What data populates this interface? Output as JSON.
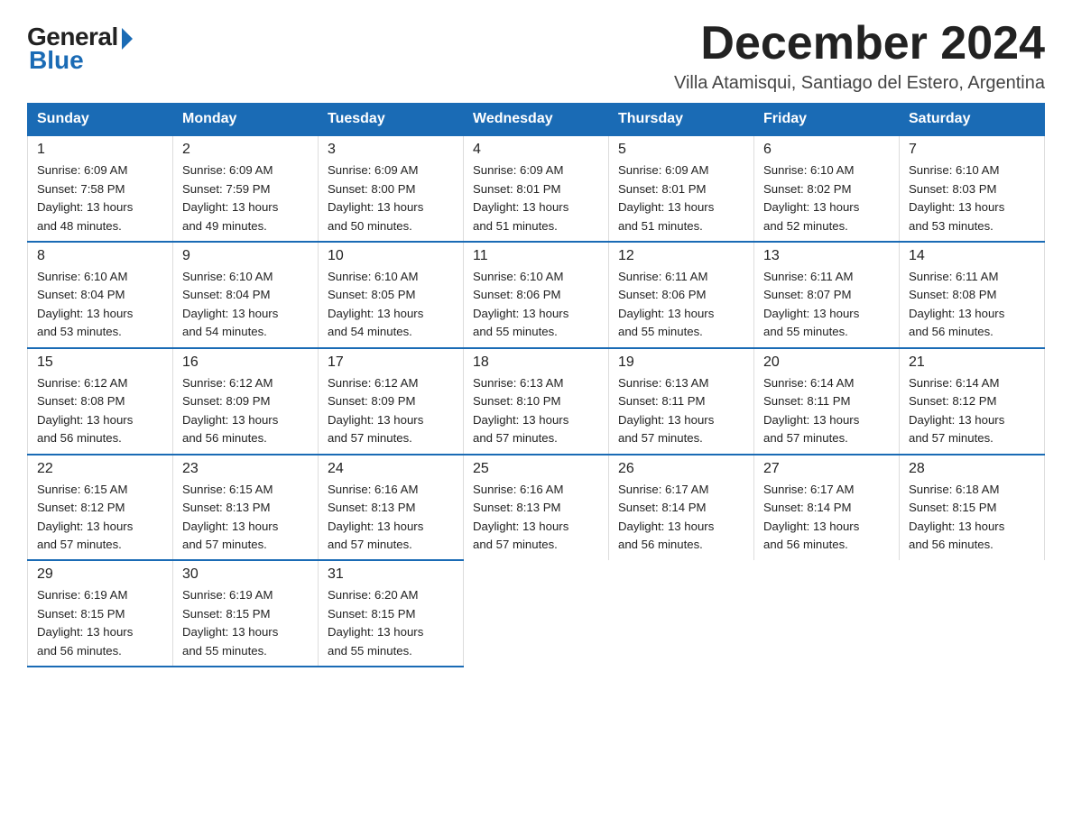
{
  "logo": {
    "general": "General",
    "blue": "Blue"
  },
  "title": "December 2024",
  "subtitle": "Villa Atamisqui, Santiago del Estero, Argentina",
  "days_of_week": [
    "Sunday",
    "Monday",
    "Tuesday",
    "Wednesday",
    "Thursday",
    "Friday",
    "Saturday"
  ],
  "weeks": [
    [
      {
        "day": "1",
        "sunrise": "6:09 AM",
        "sunset": "7:58 PM",
        "daylight": "13 hours and 48 minutes."
      },
      {
        "day": "2",
        "sunrise": "6:09 AM",
        "sunset": "7:59 PM",
        "daylight": "13 hours and 49 minutes."
      },
      {
        "day": "3",
        "sunrise": "6:09 AM",
        "sunset": "8:00 PM",
        "daylight": "13 hours and 50 minutes."
      },
      {
        "day": "4",
        "sunrise": "6:09 AM",
        "sunset": "8:01 PM",
        "daylight": "13 hours and 51 minutes."
      },
      {
        "day": "5",
        "sunrise": "6:09 AM",
        "sunset": "8:01 PM",
        "daylight": "13 hours and 51 minutes."
      },
      {
        "day": "6",
        "sunrise": "6:10 AM",
        "sunset": "8:02 PM",
        "daylight": "13 hours and 52 minutes."
      },
      {
        "day": "7",
        "sunrise": "6:10 AM",
        "sunset": "8:03 PM",
        "daylight": "13 hours and 53 minutes."
      }
    ],
    [
      {
        "day": "8",
        "sunrise": "6:10 AM",
        "sunset": "8:04 PM",
        "daylight": "13 hours and 53 minutes."
      },
      {
        "day": "9",
        "sunrise": "6:10 AM",
        "sunset": "8:04 PM",
        "daylight": "13 hours and 54 minutes."
      },
      {
        "day": "10",
        "sunrise": "6:10 AM",
        "sunset": "8:05 PM",
        "daylight": "13 hours and 54 minutes."
      },
      {
        "day": "11",
        "sunrise": "6:10 AM",
        "sunset": "8:06 PM",
        "daylight": "13 hours and 55 minutes."
      },
      {
        "day": "12",
        "sunrise": "6:11 AM",
        "sunset": "8:06 PM",
        "daylight": "13 hours and 55 minutes."
      },
      {
        "day": "13",
        "sunrise": "6:11 AM",
        "sunset": "8:07 PM",
        "daylight": "13 hours and 55 minutes."
      },
      {
        "day": "14",
        "sunrise": "6:11 AM",
        "sunset": "8:08 PM",
        "daylight": "13 hours and 56 minutes."
      }
    ],
    [
      {
        "day": "15",
        "sunrise": "6:12 AM",
        "sunset": "8:08 PM",
        "daylight": "13 hours and 56 minutes."
      },
      {
        "day": "16",
        "sunrise": "6:12 AM",
        "sunset": "8:09 PM",
        "daylight": "13 hours and 56 minutes."
      },
      {
        "day": "17",
        "sunrise": "6:12 AM",
        "sunset": "8:09 PM",
        "daylight": "13 hours and 57 minutes."
      },
      {
        "day": "18",
        "sunrise": "6:13 AM",
        "sunset": "8:10 PM",
        "daylight": "13 hours and 57 minutes."
      },
      {
        "day": "19",
        "sunrise": "6:13 AM",
        "sunset": "8:11 PM",
        "daylight": "13 hours and 57 minutes."
      },
      {
        "day": "20",
        "sunrise": "6:14 AM",
        "sunset": "8:11 PM",
        "daylight": "13 hours and 57 minutes."
      },
      {
        "day": "21",
        "sunrise": "6:14 AM",
        "sunset": "8:12 PM",
        "daylight": "13 hours and 57 minutes."
      }
    ],
    [
      {
        "day": "22",
        "sunrise": "6:15 AM",
        "sunset": "8:12 PM",
        "daylight": "13 hours and 57 minutes."
      },
      {
        "day": "23",
        "sunrise": "6:15 AM",
        "sunset": "8:13 PM",
        "daylight": "13 hours and 57 minutes."
      },
      {
        "day": "24",
        "sunrise": "6:16 AM",
        "sunset": "8:13 PM",
        "daylight": "13 hours and 57 minutes."
      },
      {
        "day": "25",
        "sunrise": "6:16 AM",
        "sunset": "8:13 PM",
        "daylight": "13 hours and 57 minutes."
      },
      {
        "day": "26",
        "sunrise": "6:17 AM",
        "sunset": "8:14 PM",
        "daylight": "13 hours and 56 minutes."
      },
      {
        "day": "27",
        "sunrise": "6:17 AM",
        "sunset": "8:14 PM",
        "daylight": "13 hours and 56 minutes."
      },
      {
        "day": "28",
        "sunrise": "6:18 AM",
        "sunset": "8:15 PM",
        "daylight": "13 hours and 56 minutes."
      }
    ],
    [
      {
        "day": "29",
        "sunrise": "6:19 AM",
        "sunset": "8:15 PM",
        "daylight": "13 hours and 56 minutes."
      },
      {
        "day": "30",
        "sunrise": "6:19 AM",
        "sunset": "8:15 PM",
        "daylight": "13 hours and 55 minutes."
      },
      {
        "day": "31",
        "sunrise": "6:20 AM",
        "sunset": "8:15 PM",
        "daylight": "13 hours and 55 minutes."
      },
      null,
      null,
      null,
      null
    ]
  ],
  "labels": {
    "sunrise": "Sunrise:",
    "sunset": "Sunset:",
    "daylight": "Daylight:"
  }
}
